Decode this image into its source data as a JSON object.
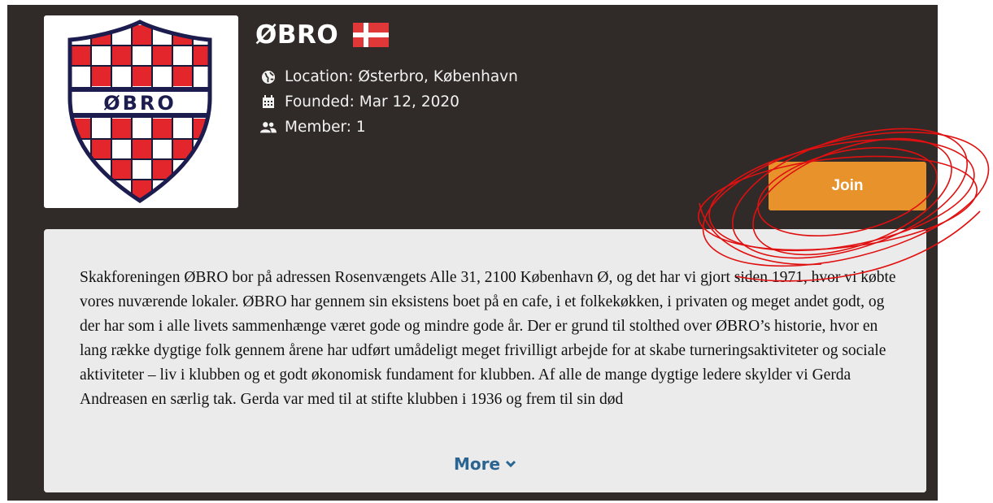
{
  "club": {
    "name": "ØBRO",
    "logo_text": "ØBRO",
    "flag_icon": "denmark-flag-icon",
    "location_icon": "globe-icon",
    "location": "Location: Østerbro, København",
    "founded_icon": "calendar-icon",
    "founded": "Founded: Mar 12, 2020",
    "members_icon": "users-icon",
    "members": "Member: 1"
  },
  "actions": {
    "join_label": "Join"
  },
  "description": {
    "text": "Skakforeningen ØBRO bor på adressen Rosenvængets Alle 31, 2100 København Ø, og det har vi gjort siden 1971, hvor vi købte vores nuværende lokaler. ØBRO har gennem sin eksistens boet på en cafe, i et folkekøkken, i privaten og meget andet godt, og der har som i alle livets sammenhænge været gode og mindre gode år. Der er grund til stolthed over ØBRO’s historie, hvor en lang række dygtige folk gennem årene har udført umådeligt meget frivilligt arbejde for at skabe turneringsaktiviteter og sociale aktiviteter – liv i klubben og et godt økonomisk fundament for klubben. Af alle de mange dygtige ledere skylder vi Gerda Andreasen en særlig tak. Gerda var med til at stifte klubben i 1936 og frem til sin død",
    "more_label": "More",
    "more_icon": "chevron-down-icon"
  },
  "colors": {
    "panel_bg": "#302b29",
    "join_button": "#e8922c",
    "more_link": "#2a6592",
    "annotation": "#e01010"
  }
}
